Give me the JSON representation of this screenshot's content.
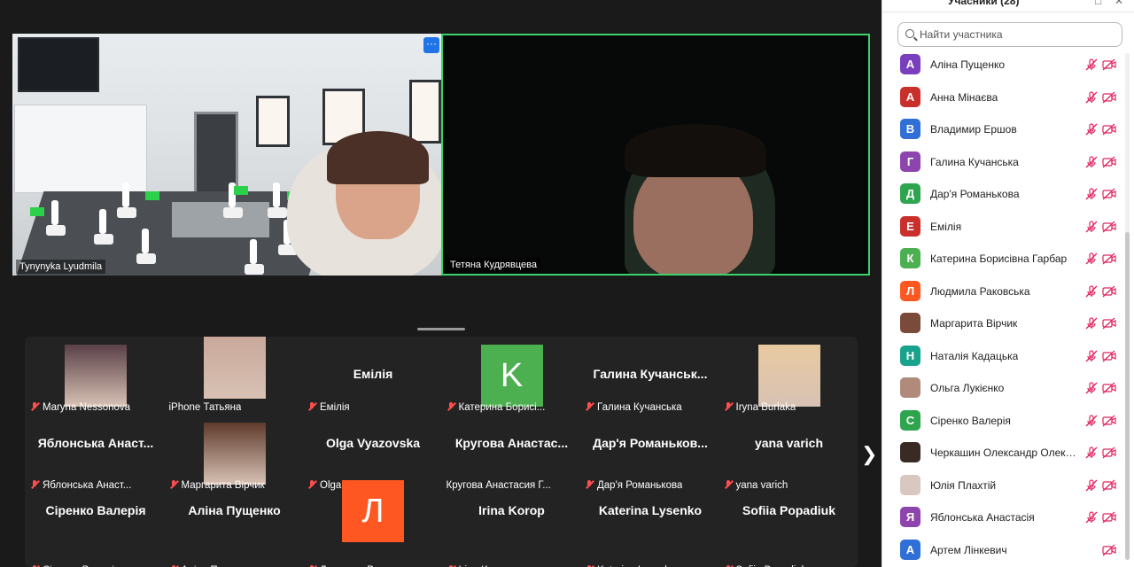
{
  "panel": {
    "title": "Учасники (28)",
    "search_placeholder": "Найти участника",
    "participants": [
      {
        "initial": "А",
        "color": "#7a3fbf",
        "name": "Аліна Пущенко",
        "mic_muted": true,
        "cam_off": true
      },
      {
        "initial": "А",
        "color": "#c9302c",
        "name": "Анна Мінаєва",
        "mic_muted": true,
        "cam_off": true
      },
      {
        "initial": "В",
        "color": "#2f6fd6",
        "name": "Владимир Ершов",
        "mic_muted": true,
        "cam_off": true
      },
      {
        "initial": "Г",
        "color": "#8e44ad",
        "name": "Галина Кучанська",
        "mic_muted": true,
        "cam_off": true
      },
      {
        "initial": "Д",
        "color": "#2ea44f",
        "name": "Дар'я Романькова",
        "mic_muted": true,
        "cam_off": true
      },
      {
        "initial": "Е",
        "color": "#c9302c",
        "name": "Емілія",
        "mic_muted": true,
        "cam_off": true
      },
      {
        "initial": "К",
        "color": "#4caf50",
        "name": "Катерина Борисівна Гарбар",
        "mic_muted": true,
        "cam_off": true
      },
      {
        "initial": "Л",
        "color": "#ff5722",
        "name": "Людмила Раковська",
        "mic_muted": true,
        "cam_off": true
      },
      {
        "initial": "",
        "color": "#7a4a3a",
        "name": "Маргарита Вірчик",
        "mic_muted": true,
        "cam_off": true
      },
      {
        "initial": "Н",
        "color": "#1aa38c",
        "name": "Наталія Кадацька",
        "mic_muted": true,
        "cam_off": true
      },
      {
        "initial": "",
        "color": "#b08a7a",
        "name": "Ольга Лукієнко",
        "mic_muted": true,
        "cam_off": true
      },
      {
        "initial": "С",
        "color": "#2ea44f",
        "name": "Сіренко Валерія",
        "mic_muted": true,
        "cam_off": true
      },
      {
        "initial": "",
        "color": "#3a2a24",
        "name": "Черкашин Олександр Олекса...",
        "mic_muted": true,
        "cam_off": true
      },
      {
        "initial": "",
        "color": "#d9c8c0",
        "name": "Юлія Плахтій",
        "mic_muted": true,
        "cam_off": true
      },
      {
        "initial": "Я",
        "color": "#8e44ad",
        "name": "Яблонська Анастасія",
        "mic_muted": true,
        "cam_off": true
      },
      {
        "initial": "А",
        "color": "#2f6fd6",
        "name": "Артем Лінкевич",
        "mic_muted": false,
        "cam_off": true
      }
    ]
  },
  "videos": {
    "left_name": "Tynynyka Lyudmila",
    "right_name": "Тетяна Кудрявцева",
    "menu_label": "···"
  },
  "gallery": [
    {
      "big": "",
      "label": "Maryna Nessonova",
      "muted": true,
      "kind": "photo",
      "photo": "#5a4048"
    },
    {
      "big": "",
      "label": "iPhone Татьяна",
      "muted": false,
      "kind": "photo",
      "photo": "#c9a89a"
    },
    {
      "big": "Емілія",
      "label": "Емілія",
      "muted": true,
      "kind": "name"
    },
    {
      "big": "",
      "label": "Катерина Борисі...",
      "muted": true,
      "kind": "letter",
      "letter": "K",
      "color": "#4caf50"
    },
    {
      "big": "Галина  Кучанськ...",
      "label": "Галина Кучанська",
      "muted": true,
      "kind": "name"
    },
    {
      "big": "",
      "label": "Iryna Burlaka",
      "muted": true,
      "kind": "photo",
      "photo": "#e8c9a0"
    },
    {
      "big": "Яблонська  Анаст...",
      "label": "Яблонська Анаст...",
      "muted": true,
      "kind": "name"
    },
    {
      "big": "",
      "label": "Маргарита Вірчик",
      "muted": true,
      "kind": "photo",
      "photo": "#5e3a2c"
    },
    {
      "big": "Olga Vyazovska",
      "label": "Olga Vyazovska",
      "muted": true,
      "kind": "name"
    },
    {
      "big": "Кругова  Анастас...",
      "label": "Кругова Анастасия Г...",
      "muted": false,
      "kind": "name"
    },
    {
      "big": "Дар'я  Романьков...",
      "label": "Дар'я Романькова",
      "muted": true,
      "kind": "name"
    },
    {
      "big": "yana varich",
      "label": "yana varich",
      "muted": true,
      "kind": "name"
    },
    {
      "big": "Сіренко Валерія",
      "label": "Сіренко Валерія",
      "muted": true,
      "kind": "name"
    },
    {
      "big": "Аліна Пущенко",
      "label": "Аліна Пущенко",
      "muted": true,
      "kind": "name"
    },
    {
      "big": "",
      "label": "Людмила Раковсь...",
      "muted": true,
      "kind": "letter",
      "letter": "Л",
      "color": "#ff5722"
    },
    {
      "big": "Irina Korop",
      "label": "Irina Korop",
      "muted": true,
      "kind": "name"
    },
    {
      "big": "Katerina Lysenko",
      "label": "Katerina Lysenko",
      "muted": true,
      "kind": "name"
    },
    {
      "big": "Sofiia Popadiuk",
      "label": "Sofiia Popadiuk",
      "muted": true,
      "kind": "name"
    }
  ]
}
